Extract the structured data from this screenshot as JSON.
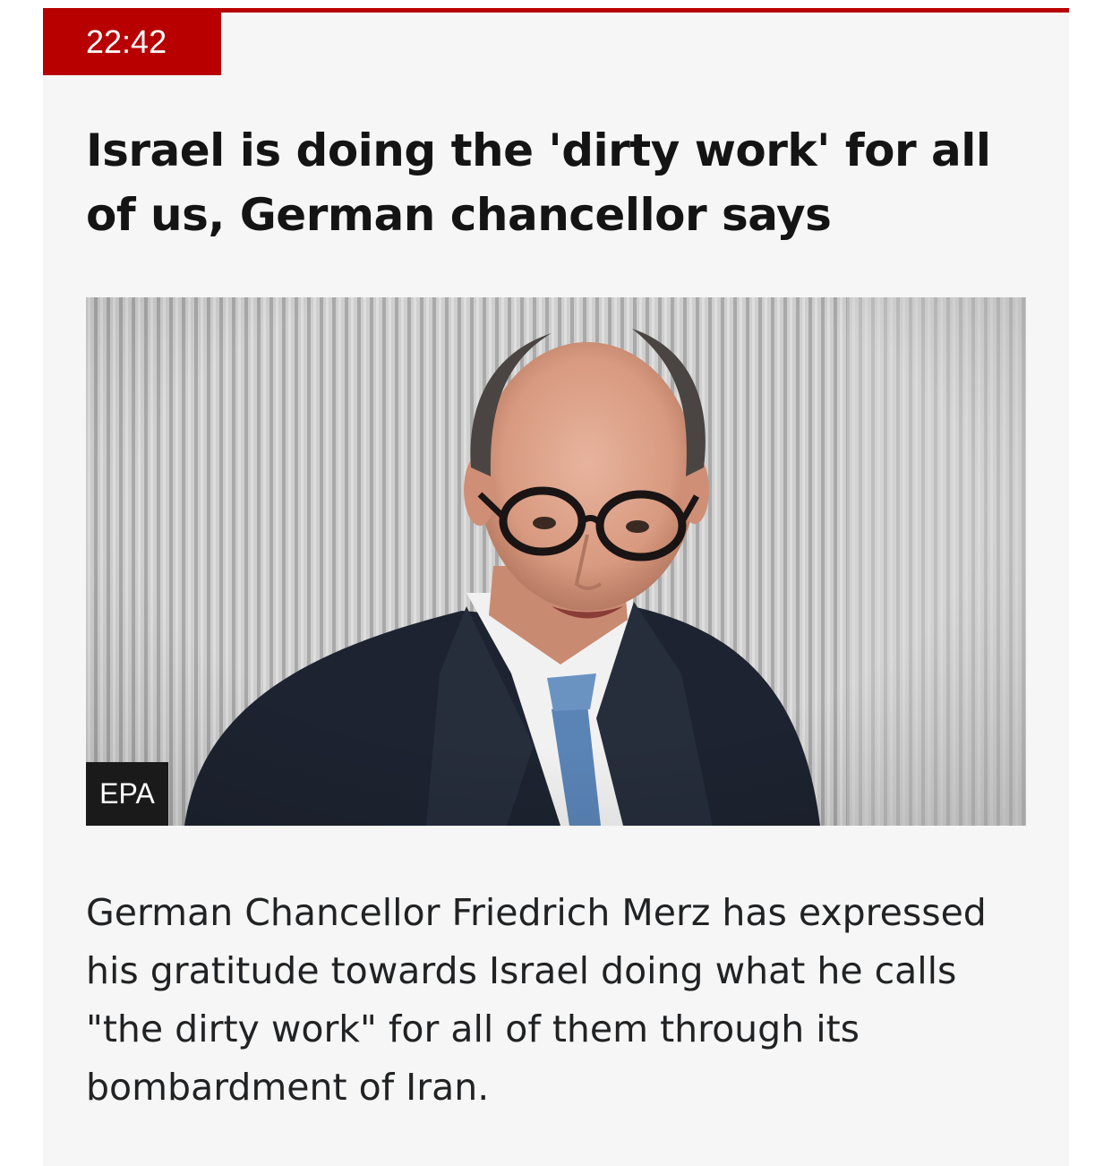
{
  "post": {
    "time": "22:42",
    "headline": "Israel is doing the 'dirty work' for all of us, German chancellor says",
    "image_credit": "EPA",
    "summary": "German Chancellor Friedrich Merz has expressed his gratitude towards Israel doing what he calls \"the dirty work\" for all of them through its bombardment of Iran."
  },
  "colors": {
    "accent": "#b80000",
    "card_background": "#f6f6f6",
    "text": "#141414"
  }
}
